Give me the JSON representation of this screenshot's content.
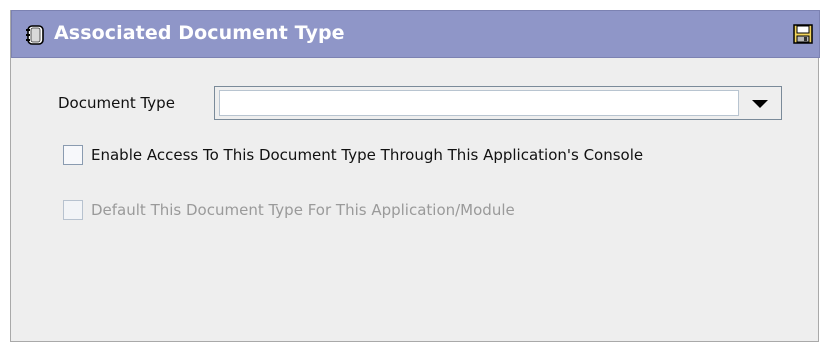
{
  "header": {
    "title": "Associated Document Type",
    "title_icon": "notebook-icon",
    "save_icon": "save-disk-icon",
    "background_color": "#8f96c8"
  },
  "form": {
    "document_type": {
      "label": "Document Type",
      "selected_value": ""
    },
    "enable_access": {
      "label": "Enable Access To This Document Type Through This Application's Console",
      "checked": false,
      "enabled": true
    },
    "default_type": {
      "label": "Default This Document Type For This Application/Module",
      "checked": false,
      "enabled": false
    }
  }
}
